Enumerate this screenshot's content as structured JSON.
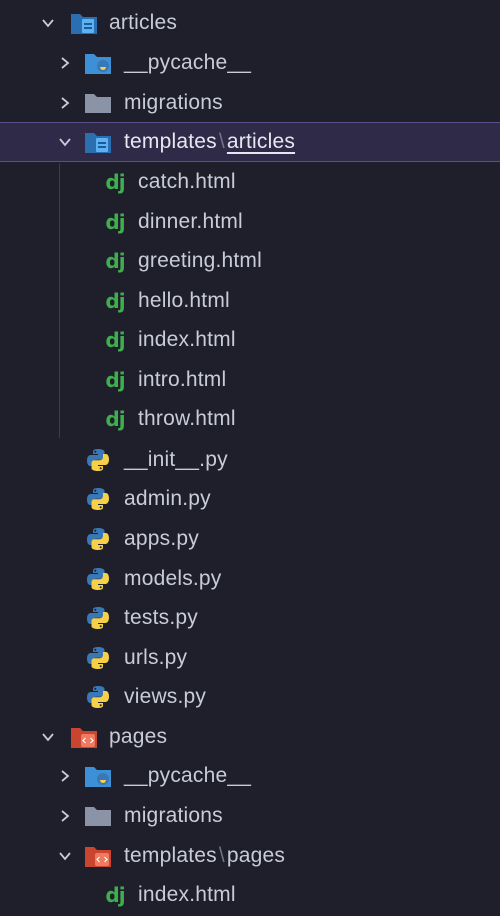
{
  "explorer": {
    "items": [
      {
        "label": "articles",
        "kind": "folder-open"
      },
      {
        "label": "__pycache__",
        "kind": "folder-closed"
      },
      {
        "label": "migrations",
        "kind": "folder-closed"
      },
      {
        "label": "templates",
        "sep": "\\",
        "label2": "articles",
        "kind": "folder-open"
      },
      {
        "label": "catch.html",
        "kind": "file"
      },
      {
        "label": "dinner.html",
        "kind": "file"
      },
      {
        "label": "greeting.html",
        "kind": "file"
      },
      {
        "label": "hello.html",
        "kind": "file"
      },
      {
        "label": "index.html",
        "kind": "file"
      },
      {
        "label": "intro.html",
        "kind": "file"
      },
      {
        "label": "throw.html",
        "kind": "file"
      },
      {
        "label": "__init__.py",
        "kind": "file"
      },
      {
        "label": "admin.py",
        "kind": "file"
      },
      {
        "label": "apps.py",
        "kind": "file"
      },
      {
        "label": "models.py",
        "kind": "file"
      },
      {
        "label": "tests.py",
        "kind": "file"
      },
      {
        "label": "urls.py",
        "kind": "file"
      },
      {
        "label": "views.py",
        "kind": "file"
      },
      {
        "label": "pages",
        "kind": "folder-open"
      },
      {
        "label": "__pycache__",
        "kind": "folder-closed"
      },
      {
        "label": "migrations",
        "kind": "folder-closed"
      },
      {
        "label": "templates",
        "sep": "\\",
        "label2": "pages",
        "kind": "folder-open"
      },
      {
        "label": "index.html",
        "kind": "file"
      }
    ],
    "django_icon_text": "dj",
    "colors": {
      "background": "#1e1f2b",
      "selected_background": "#2f2a48",
      "selected_border": "#5a4f8a",
      "text": "#c9ccd6",
      "django_green": "#3fae4d",
      "python_blue": "#3a78b5",
      "python_yellow": "#f7d04a",
      "folder_blue": "#3d8fd6",
      "folder_gray": "#8b93a6",
      "folder_orange": "#e8664a"
    }
  }
}
